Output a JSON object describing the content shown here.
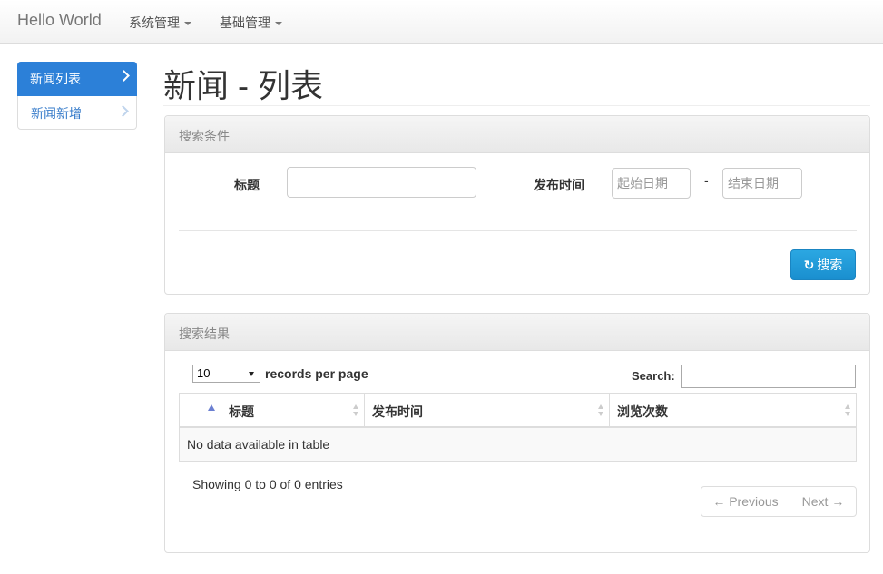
{
  "navbar": {
    "brand": "Hello World",
    "menus": [
      {
        "label": "系统管理"
      },
      {
        "label": "基础管理"
      }
    ]
  },
  "sidebar": {
    "items": [
      {
        "label": "新闻列表",
        "active": true
      },
      {
        "label": "新闻新增",
        "active": false
      }
    ]
  },
  "page": {
    "title": "新闻 - 列表"
  },
  "search_panel": {
    "heading": "搜索条件",
    "title_label": "标题",
    "title_value": "",
    "date_label": "发布时间",
    "start_placeholder": "起始日期",
    "end_placeholder": "结束日期",
    "dash": "-",
    "search_button": "搜索"
  },
  "results_panel": {
    "heading": "搜索结果",
    "page_length": "10",
    "records_per_page": "records per page",
    "search_label": "Search:",
    "search_value": "",
    "columns": [
      "",
      "标题",
      "发布时间",
      "浏览次数"
    ],
    "empty_message": "No data available in table",
    "info": "Showing 0 to 0 of 0 entries",
    "prev": "← Previous",
    "next": "Next →"
  },
  "colors": {
    "primary": "#2c80d8",
    "search_button": "#1a8fcf",
    "sort_active": "#6b7fd1"
  }
}
